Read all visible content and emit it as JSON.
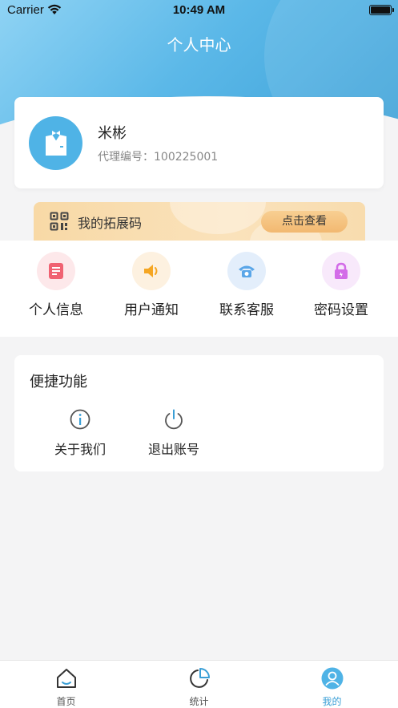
{
  "status_bar": {
    "carrier": "Carrier",
    "time": "10:49 AM"
  },
  "header": {
    "title": "个人中心"
  },
  "profile": {
    "name": "米彬",
    "agent_label": "代理编号：",
    "agent_id": "100225001"
  },
  "promo": {
    "label": "我的拓展码",
    "button_label": "点击查看"
  },
  "quick_menu": [
    {
      "label": "个人信息",
      "icon": "profile-document-icon",
      "color": "#f06272"
    },
    {
      "label": "用户通知",
      "icon": "speaker-icon",
      "color": "#f5a623"
    },
    {
      "label": "联系客服",
      "icon": "telephone-icon",
      "color": "#5aa6e8"
    },
    {
      "label": "密码设置",
      "icon": "lock-icon",
      "color": "#d36ce8"
    }
  ],
  "shortcuts": {
    "title": "便捷功能",
    "items": [
      {
        "label": "关于我们",
        "icon": "info-icon"
      },
      {
        "label": "退出账号",
        "icon": "power-icon"
      }
    ]
  },
  "tab_bar": {
    "tabs": [
      {
        "label": "首页",
        "icon": "home-icon"
      },
      {
        "label": "统计",
        "icon": "pie-chart-icon"
      },
      {
        "label": "我的",
        "icon": "user-icon",
        "active": true
      }
    ]
  },
  "colors": {
    "accent": "#3a9fd6",
    "header_start": "#8fd3f4",
    "promo_bg": "#f8d9a6",
    "promo_button": "#f2b870"
  }
}
